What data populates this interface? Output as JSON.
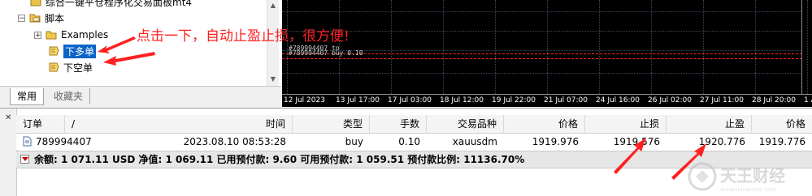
{
  "navigator": {
    "items": [
      {
        "label": "综合一键平仓程序化交易面板mt4"
      },
      {
        "label": "脚本"
      },
      {
        "label": "Examples"
      },
      {
        "label": "下多单"
      },
      {
        "label": "下空单"
      }
    ],
    "tabs": [
      {
        "label": "常用"
      },
      {
        "label": "收藏夹"
      }
    ]
  },
  "annotation": {
    "text": "点击一下，自动止盈止损，很方便!",
    "color": "#ff2020"
  },
  "chart": {
    "trade_labels": [
      "#789994407 tp",
      "#789994407 buy 0.10"
    ],
    "time_axis": [
      "12 Jul 2023",
      "13 Jul 17:00",
      "17 Jul 03:00",
      "18 Jul 12:00",
      "19 Jul 22:00",
      "21 Jul 07:00",
      "24 Jul 16:00",
      "26 Jul 02:00",
      "27 Jul 11:00",
      "28 Jul 20:00",
      "1 Aug"
    ],
    "colors": {
      "background": "#000000",
      "grid": "#3b4a5a",
      "order_line": "#ff2a2a"
    }
  },
  "terminal": {
    "columns": [
      "订单",
      "/",
      "时间",
      "类型",
      "手数",
      "交易品种",
      "价格",
      "止损",
      "止盈",
      "价格"
    ],
    "order": {
      "ticket": "789994407",
      "time": "2023.08.10 08:53:28",
      "type": "buy",
      "lots": "0.10",
      "symbol": "xauusdm",
      "open_price": "1919.976",
      "sl": "1919.576",
      "tp": "1920.776",
      "price": "1919.776"
    },
    "balance_line": "余额: 1 071.11 USD  净值: 1 069.11  已用预付款: 9.60  可用预付款: 1 059.51  预付款比例: 11136.70%"
  },
  "watermark": {
    "logo_text": "天王财经",
    "url_text": "www.tianwang.com"
  }
}
